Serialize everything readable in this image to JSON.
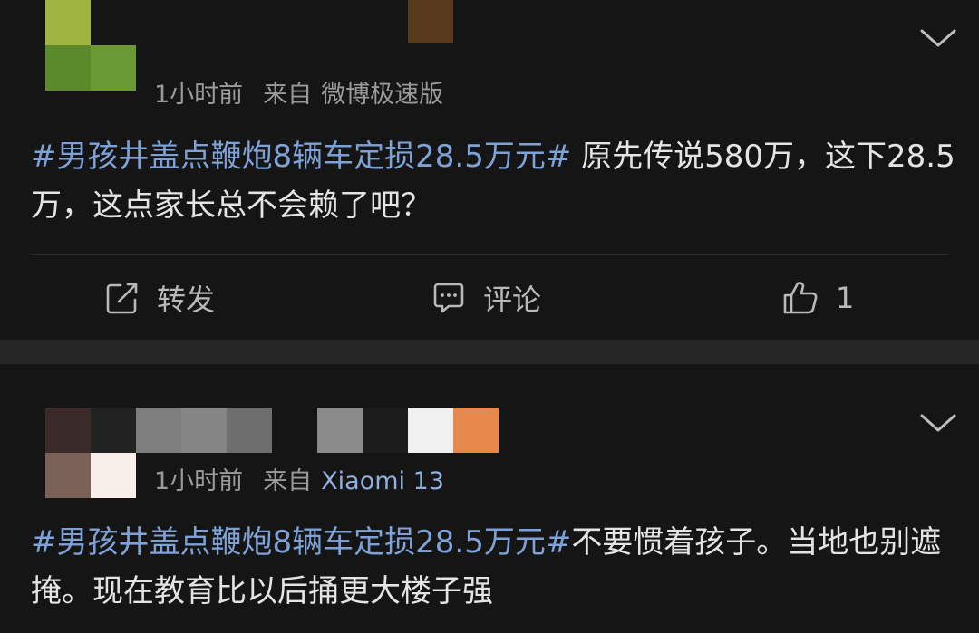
{
  "posts": [
    {
      "meta": {
        "time": "1小时前",
        "source_prefix": "来自",
        "source": "微博极速版"
      },
      "content": {
        "hashtag": "#男孩井盖点鞭炮8辆车定损28.5万元#",
        "text": "  原先传说580万，这下28.5万，这点家长总不会赖了吧？"
      },
      "actions": {
        "repost_label": "转发",
        "comment_label": "评论",
        "like_count": "1"
      }
    },
    {
      "meta": {
        "time": "1小时前",
        "source_prefix": "来自",
        "source": "Xiaomi 13"
      },
      "content": {
        "hashtag": "#男孩井盖点鞭炮8辆车定损28.5万元#",
        "text": "不要惯着孩子。当地也别遮掩。现在教育比以后捅更大楼子强"
      }
    }
  ],
  "icons": {
    "more": "chevron-down-icon",
    "repost": "repost-icon",
    "comment": "comment-icon",
    "like": "thumbs-up-icon"
  },
  "colors": {
    "background": "#151515",
    "separator": "#262626",
    "hashtag": "#7ea2d8",
    "meta_text": "#9a9a9a"
  }
}
